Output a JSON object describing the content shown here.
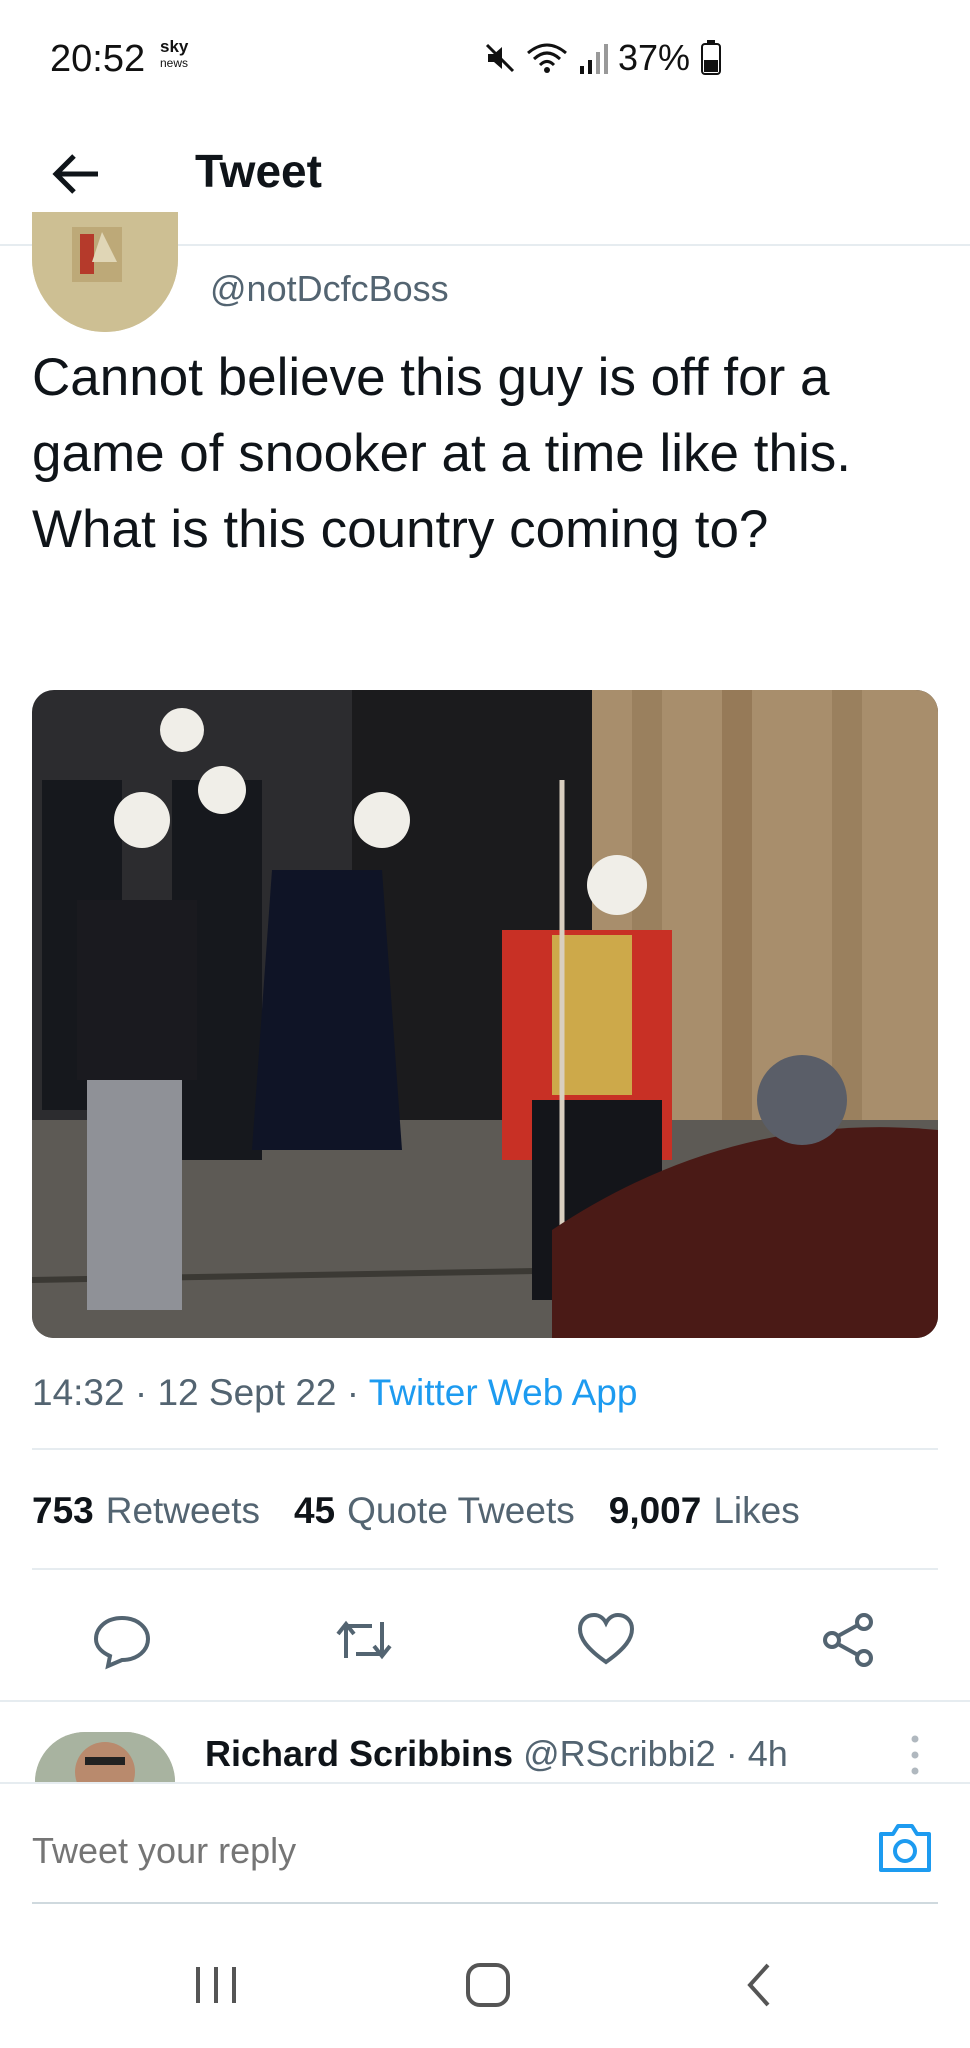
{
  "status_bar": {
    "time": "20:52",
    "notif_brand": "sky",
    "notif_sub": "news",
    "battery": "37%"
  },
  "header": {
    "title": "Tweet"
  },
  "tweet": {
    "handle": "@notDcfcBoss",
    "text": "Cannot believe this guy is off for a game of snooker at a time like this. What is this country coming to?",
    "time": "14:32",
    "date": "12 Sept 22",
    "source": "Twitter Web App",
    "stats": {
      "retweets_count": "753",
      "retweets_label": "Retweets",
      "quotes_count": "45",
      "quotes_label": "Quote Tweets",
      "likes_count": "9,007",
      "likes_label": "Likes"
    },
    "actions": [
      "reply-icon",
      "retweet-icon",
      "like-icon",
      "share-icon"
    ]
  },
  "reply_preview": {
    "name": "Richard Scribbins",
    "handle": "@RScribbi2",
    "age": "4h"
  },
  "composer": {
    "placeholder": "Tweet your reply"
  },
  "colors": {
    "accent": "#1d9bf0",
    "secondary_text": "#536471",
    "divider": "#e6ecf0"
  }
}
